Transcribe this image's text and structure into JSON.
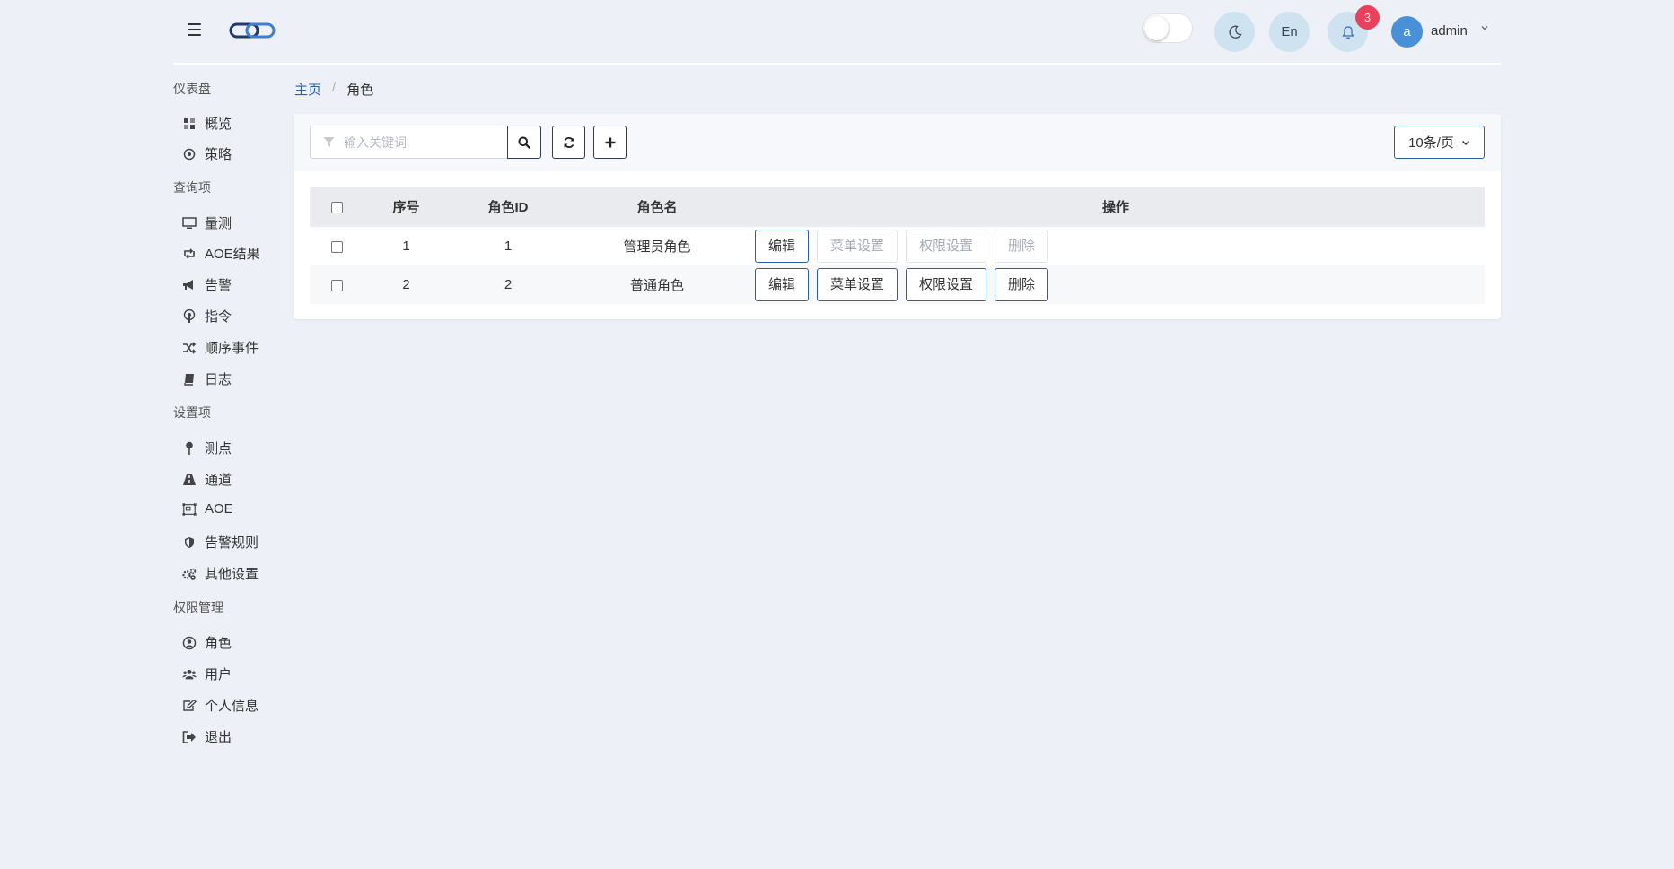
{
  "header": {
    "theme_button_label": "",
    "lang_button_label": "En",
    "notification_count": "3",
    "avatar_letter": "a",
    "username": "admin"
  },
  "sidebar": {
    "sections": [
      {
        "title": "仪表盘",
        "items": [
          {
            "label": "概览",
            "icon": "dashboard-icon"
          },
          {
            "label": "策略",
            "icon": "compass-icon"
          }
        ]
      },
      {
        "title": "查询项",
        "items": [
          {
            "label": "量测",
            "icon": "desktop-icon"
          },
          {
            "label": "AOE结果",
            "icon": "retweet-icon"
          },
          {
            "label": "告警",
            "icon": "bullhorn-icon"
          },
          {
            "label": "指令",
            "icon": "podcast-icon"
          },
          {
            "label": "顺序事件",
            "icon": "random-icon"
          },
          {
            "label": "日志",
            "icon": "book-icon"
          }
        ]
      },
      {
        "title": "设置项",
        "items": [
          {
            "label": "测点",
            "icon": "map-pin-icon"
          },
          {
            "label": "通道",
            "icon": "road-icon"
          },
          {
            "label": "AOE",
            "icon": "object-group-icon"
          },
          {
            "label": "告警规则",
            "icon": "shield-icon"
          },
          {
            "label": "其他设置",
            "icon": "cogs-icon"
          }
        ]
      },
      {
        "title": "权限管理",
        "items": [
          {
            "label": "角色",
            "icon": "user-circle-icon"
          },
          {
            "label": "用户",
            "icon": "users-icon"
          },
          {
            "label": "个人信息",
            "icon": "edit-icon"
          },
          {
            "label": "退出",
            "icon": "sign-out-icon"
          }
        ]
      }
    ]
  },
  "breadcrumb": {
    "home": "主页",
    "separator": "/",
    "current": "角色"
  },
  "toolbar": {
    "search_placeholder": "输入关键词",
    "page_size": "10条/页"
  },
  "table": {
    "headers": [
      "序号",
      "角色ID",
      "角色名",
      "操作"
    ],
    "rows": [
      {
        "no": "1",
        "id": "1",
        "name": "管理员角色",
        "actions": [
          {
            "label": "编辑",
            "enabled": true
          },
          {
            "label": "菜单设置",
            "enabled": false
          },
          {
            "label": "权限设置",
            "enabled": false
          },
          {
            "label": "删除",
            "enabled": false
          }
        ]
      },
      {
        "no": "2",
        "id": "2",
        "name": "普通角色",
        "actions": [
          {
            "label": "编辑",
            "enabled": true
          },
          {
            "label": "菜单设置",
            "enabled": true
          },
          {
            "label": "权限设置",
            "enabled": true
          },
          {
            "label": "删除",
            "enabled": true
          }
        ]
      }
    ]
  },
  "colors": {
    "background": "#edf1f7",
    "primary": "#2d5ea8",
    "badge": "#e8415b",
    "avatar": "#4a90d9",
    "circle_button": "#cfe2ef"
  }
}
